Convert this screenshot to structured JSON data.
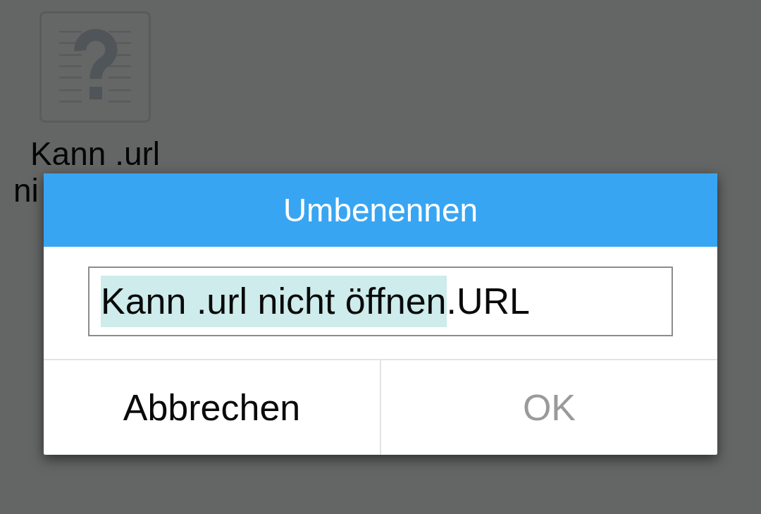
{
  "desktop": {
    "items": [
      {
        "label_lines": [
          "Kann .url",
          "ni"
        ]
      }
    ]
  },
  "dialog": {
    "title": "Umbenennen",
    "field": {
      "segments": [
        {
          "text": "Kann .url nicht öffnen",
          "selected": true
        },
        {
          "text": ".URL",
          "selected": false
        }
      ]
    },
    "buttons": [
      {
        "label": "Abbrechen",
        "disabled": false
      },
      {
        "label": "OK",
        "disabled": true
      }
    ]
  }
}
